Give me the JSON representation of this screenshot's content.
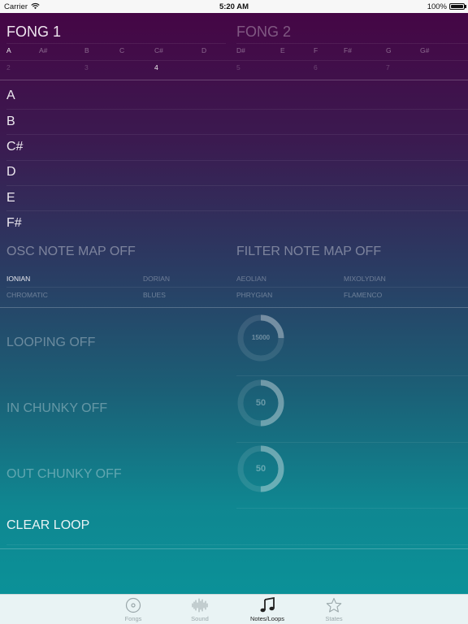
{
  "status_bar": {
    "carrier": "Carrier",
    "time": "5:20 AM",
    "battery": "100%"
  },
  "fong1": {
    "title": "FONG 1",
    "notes": [
      "A",
      "A#",
      "B",
      "C",
      "C#",
      "D"
    ],
    "numbers": [
      "2",
      "3",
      "4"
    ],
    "selected_note": "A",
    "selected_number": "4"
  },
  "fong2": {
    "title": "FONG 2",
    "notes": [
      "D#",
      "E",
      "F",
      "F#",
      "G",
      "G#"
    ],
    "numbers": [
      "5",
      "6",
      "7"
    ]
  },
  "scale_notes": [
    "A",
    "B",
    "C#",
    "D",
    "E",
    "F#"
  ],
  "note_maps": {
    "osc": "OSC NOTE MAP OFF",
    "filter": "FILTER NOTE MAP OFF"
  },
  "modes": {
    "left": [
      "IONIAN",
      "DORIAN",
      "CHROMATIC",
      "BLUES"
    ],
    "right": [
      "AEOLIAN",
      "MIXOLYDIAN",
      "PHRYGIAN",
      "FLAMENCO"
    ],
    "selected": "IONIAN"
  },
  "looping": {
    "label": "LOOPING OFF",
    "value": "15000",
    "fraction": 0.25
  },
  "in_chunky": {
    "label": "IN CHUNKY OFF",
    "value": "50",
    "fraction": 0.5
  },
  "out_chunky": {
    "label": "OUT CHUNKY OFF",
    "value": "50",
    "fraction": 0.5
  },
  "clear_loop": "CLEAR LOOP",
  "tabs": [
    {
      "label": "Fongs",
      "icon": "disc-icon",
      "active": false
    },
    {
      "label": "Sound",
      "icon": "waveform-icon",
      "active": false
    },
    {
      "label": "Notes/Loops",
      "icon": "music-note-icon",
      "active": true
    },
    {
      "label": "States",
      "icon": "star-icon",
      "active": false
    }
  ],
  "colors": {
    "accent": "#0b9198",
    "tab_active": "#222222",
    "tab_inactive": "#9aa7aa"
  }
}
